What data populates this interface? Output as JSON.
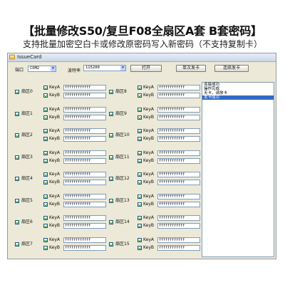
{
  "banner": {
    "title": "【批量修改S50/复旦F08全扇区A套 B套密码】",
    "subtitle": "支持批量加密空白卡或修改原密码写入新密码（不支持复制卡）"
  },
  "window": {
    "title": "IssueCard"
  },
  "controls": {
    "port_label": "端口",
    "port_value": "COM2",
    "baud_label": "波特率",
    "baud_value": "115200",
    "open_button": "打开",
    "single_button": "单次发卡",
    "continuous_button": "连续发卡"
  },
  "keyA_label": "KeyA",
  "keyB_label": "KeyB",
  "sectors": [
    {
      "label": "扇区0",
      "keyA": "ffffffffffff",
      "keyB": "ffffffffffff"
    },
    {
      "label": "扇区1",
      "keyA": "ffffffffffff",
      "keyB": "ffffffffffff"
    },
    {
      "label": "扇区2",
      "keyA": "ffffffffffff",
      "keyB": "ffffffffffff"
    },
    {
      "label": "扇区3",
      "keyA": "ffffffffffff",
      "keyB": "ffffffffffff"
    },
    {
      "label": "扇区4",
      "keyA": "ffffffffffff",
      "keyB": "ffffffffffff"
    },
    {
      "label": "扇区5",
      "keyA": "ffffffffffff",
      "keyB": "ffffffffffff"
    },
    {
      "label": "扇区6",
      "keyA": "ffffffffffff",
      "keyB": "ffffffffffff"
    },
    {
      "label": "扇区7",
      "keyA": "ffffffffffff",
      "keyB": "ffffffffffff"
    },
    {
      "label": "扇区8",
      "keyA": "ffffffffffff",
      "keyB": "ffffffffffff"
    },
    {
      "label": "扇区9",
      "keyA": "ffffffffffff",
      "keyB": "ffffffffffff"
    },
    {
      "label": "扇区10",
      "keyA": "ffffffffffff",
      "keyB": "ffffffffffff"
    },
    {
      "label": "扇区11",
      "keyA": "ffffffffffff",
      "keyB": "ffffffffffff"
    },
    {
      "label": "扇区12",
      "keyA": "ffffffffffff",
      "keyB": "ffffffffffff"
    },
    {
      "label": "扇区13",
      "keyA": "ffffffffffff",
      "keyB": "ffffffffffff"
    },
    {
      "label": "扇区14",
      "keyA": "ffffffffffff",
      "keyB": "ffffffffffff"
    },
    {
      "label": "扇区15",
      "keyA": "ffffffffffff",
      "keyB": "ffffffffffff"
    }
  ],
  "log": [
    "连接成功",
    "操作完成",
    "无卡，请放卡",
    "发卡成功"
  ]
}
